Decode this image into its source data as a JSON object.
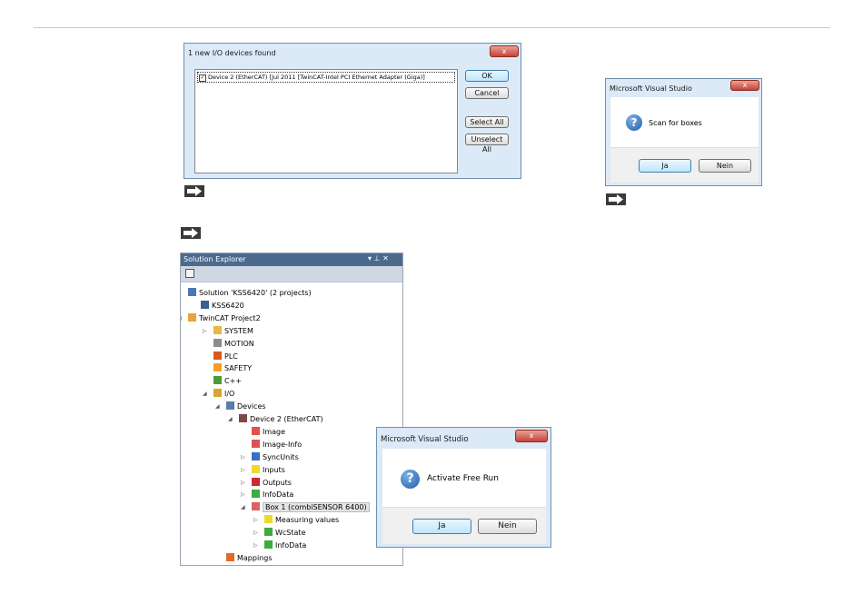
{
  "io_dialog": {
    "title": "1 new I/O devices found",
    "close_label": "x",
    "device_entry": "Device 2 (EtherCAT)     [Jul 2011 [TwinCAT-Intel PCI Ethernet Adapter (Giga)]",
    "checked": true,
    "ok_label": "OK",
    "cancel_label": "Cancel",
    "select_all_label": "Select All",
    "unselect_all_label": "Unselect All"
  },
  "scan_dialog": {
    "title": "Microsoft Visual Studio",
    "close_label": "x",
    "message": "Scan for boxes",
    "yes_label": "Ja",
    "no_label": "Nein"
  },
  "freerun_dialog": {
    "title": "Microsoft Visual Studio",
    "close_label": "x",
    "message": "Activate Free Run",
    "yes_label": "Ja",
    "no_label": "Nein"
  },
  "solution_explorer": {
    "title": "Solution Explorer",
    "pin_label": "▾ ⊥ ✕",
    "items": [
      {
        "label": "Solution 'KSS6420' (2 projects)",
        "icon": "solution-icon"
      },
      {
        "label": "KSS6420",
        "icon": "project-icon"
      },
      {
        "label": "TwinCAT Project2",
        "icon": "twincat-project-icon"
      },
      {
        "label": "SYSTEM",
        "icon": "system-icon"
      },
      {
        "label": "MOTION",
        "icon": "motion-icon"
      },
      {
        "label": "PLC",
        "icon": "plc-icon"
      },
      {
        "label": "SAFETY",
        "icon": "safety-icon"
      },
      {
        "label": "C++",
        "icon": "cpp-icon"
      },
      {
        "label": "I/O",
        "icon": "io-icon"
      },
      {
        "label": "Devices",
        "icon": "devices-icon"
      },
      {
        "label": "Device 2 (EtherCAT)",
        "icon": "ethercat-device-icon"
      },
      {
        "label": "Image",
        "icon": "image-icon"
      },
      {
        "label": "Image-Info",
        "icon": "image-info-icon"
      },
      {
        "label": "SyncUnits",
        "icon": "syncunits-icon"
      },
      {
        "label": "Inputs",
        "icon": "inputs-icon"
      },
      {
        "label": "Outputs",
        "icon": "outputs-icon"
      },
      {
        "label": "InfoData",
        "icon": "infodata-icon"
      },
      {
        "label": "Box 1 (combiSENSOR 6400)",
        "icon": "box-icon"
      },
      {
        "label": "Measuring values",
        "icon": "measuring-values-icon"
      },
      {
        "label": "WcState",
        "icon": "wcstate-icon"
      },
      {
        "label": "InfoData",
        "icon": "infodata-icon"
      },
      {
        "label": "Mappings",
        "icon": "mappings-icon"
      }
    ]
  },
  "colors": {
    "title_bar": "#4c6a8e",
    "dialog_frame": "#dce9f6",
    "close_button": "#c4423a"
  }
}
